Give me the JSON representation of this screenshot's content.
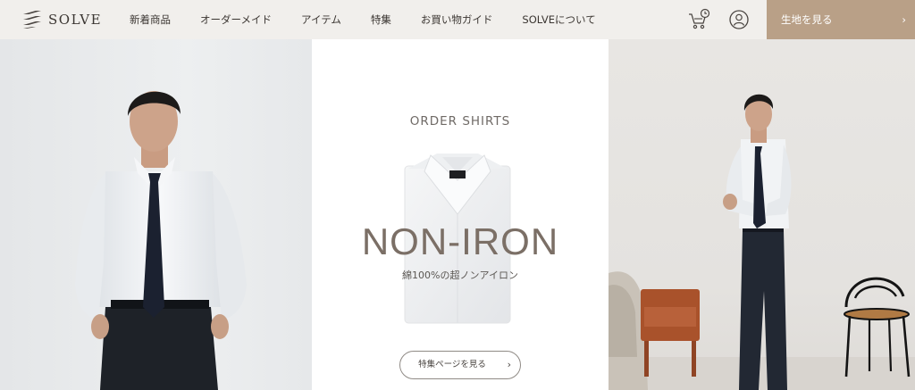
{
  "header": {
    "brand": "SOLVE",
    "nav": [
      {
        "label": "新着商品"
      },
      {
        "label": "オーダーメイド"
      },
      {
        "label": "アイテム"
      },
      {
        "label": "特集"
      },
      {
        "label": "お買い物ガイド"
      },
      {
        "label": "SOLVEについて"
      }
    ],
    "icons": {
      "cart": "cart-clock-icon",
      "user": "user-icon"
    },
    "cta": {
      "label": "生地を見る",
      "arrow": "›"
    }
  },
  "hero": {
    "eyebrow": "ORDER SHIRTS",
    "headline": "NON-IRON",
    "subline": "綿100%の超ノンアイロン",
    "button": {
      "label": "特集ページを見る",
      "arrow": "›"
    }
  },
  "colors": {
    "header_bg": "#f1efec",
    "cta_bg": "#b9a087",
    "headline": "#7b6f66",
    "text": "#3b3632"
  }
}
